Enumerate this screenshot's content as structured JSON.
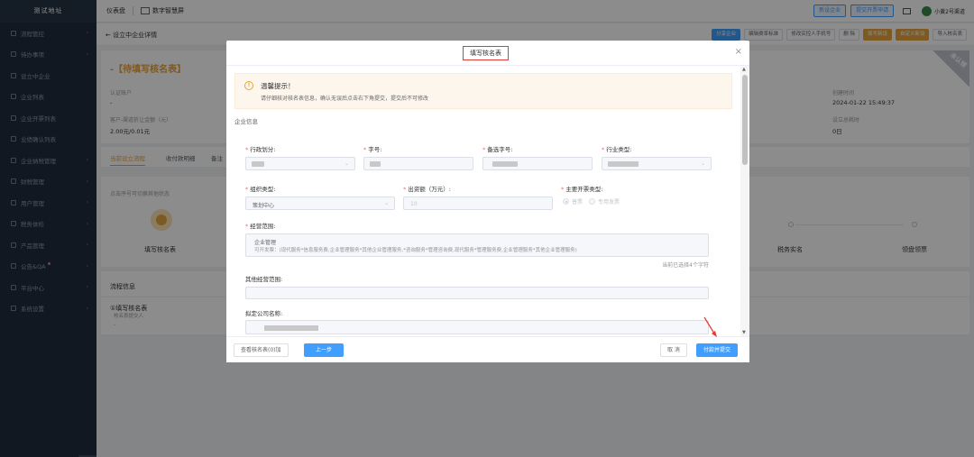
{
  "sidebar": {
    "logo": "测试地址",
    "items": [
      {
        "label": "流程管控"
      },
      {
        "label": "待办事项"
      },
      {
        "label": "设立中企业"
      },
      {
        "label": "企业列表"
      },
      {
        "label": "企业开票列表"
      },
      {
        "label": "业绩确认列表"
      },
      {
        "label": "企业纳税管理"
      },
      {
        "label": "财税管理"
      },
      {
        "label": "用户管理"
      },
      {
        "label": "税务体检"
      },
      {
        "label": "产品管理"
      },
      {
        "label": "公告&QA"
      },
      {
        "label": "平台中心"
      },
      {
        "label": "系统设置"
      }
    ]
  },
  "topbar": {
    "dashboard": "仪表盘",
    "smart_screen": "数字智慧屏",
    "btn_new_company": "新设企业",
    "btn_invoice_apply": "提交开票申请",
    "user": "小黄2号渠道"
  },
  "subbar": {
    "back": "← 设立中企业详情",
    "actions": [
      "分享企业",
      "编辑费率标准",
      "修改实控人手机号",
      "删 除",
      "填写新设",
      "自定义新设",
      "导入核名表"
    ]
  },
  "bg": {
    "status_title": "-【待填写核名表】",
    "field1_label": "认证账户",
    "field1_value": "-",
    "field2_label": "客户-渠道折让金额（元）",
    "field2_value": "2.00元/0.01元",
    "created_label": "创建时间",
    "created_value": "2024-01-22 15:49:37",
    "duration_label": "设立总耗时",
    "duration_value": "0日",
    "corner_badge": "未认领",
    "tabs": [
      "当前设立流程",
      "收付款明细",
      "备注"
    ],
    "step_hint": "点击序号可切换其他状态",
    "step1": "填写核名表",
    "step_tax": "税务实名",
    "step_tray": "领盘领票",
    "flow_title": "流程信息",
    "flow_item": "①填写核名表",
    "flow_item_sub": "核名表提交人",
    "flow_item_dash": "-"
  },
  "modal": {
    "title": "填写核名表",
    "close": "×",
    "notice_icon": "!",
    "notice_title": "温馨提示！",
    "notice_desc": "请仔细核对核名表信息，确认无误后点击右下角提交，提交后不可修改",
    "section_label": "企业信息",
    "fields": {
      "region_label": "行政划分:",
      "zihao_label": "字号:",
      "backup_label": "备选字号:",
      "industry_label": "行业类型:",
      "org_label": "组织类型:",
      "org_value": "策划中心",
      "capital_label": "出资额（万元）:",
      "capital_value": "10",
      "invoice_label": "主要开票类型:",
      "invoice_opt1": "普票",
      "invoice_opt2": "专用发票",
      "scope_label": "经营范围:",
      "scope_line1": "企业管理",
      "scope_line2": "可开发票：(现代服务*信息服务费,企业管理服务*其他企业管理服务,*咨询服务*管理咨询费,现代服务*管理服务费,企业管理服务*其他企业管理服务)",
      "scope_count": "当前已选择4个字符",
      "other_scope_label": "其他经营范围:",
      "company_name_label": "拟定公司名称:"
    },
    "footer": {
      "view_btn": "查看核名表(0)加",
      "prev_btn": "上一步",
      "cancel_btn": "取 消",
      "submit_btn": "付款并提交"
    }
  }
}
